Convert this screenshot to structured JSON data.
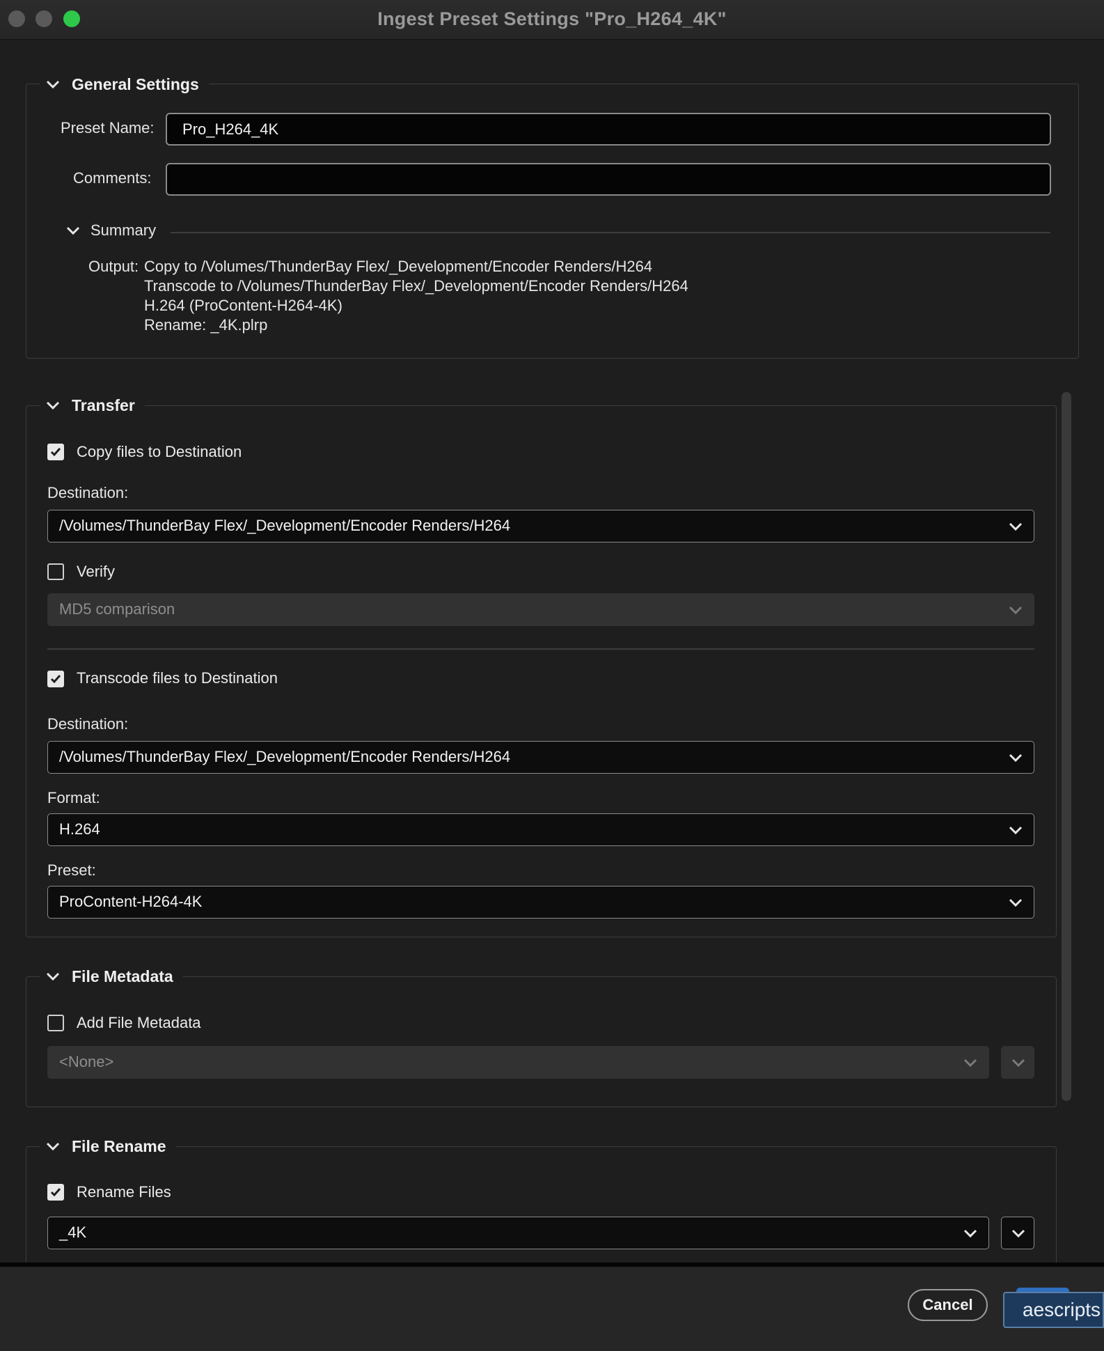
{
  "window": {
    "title": "Ingest Preset Settings \"Pro_H264_4K\""
  },
  "general": {
    "legend": "General Settings",
    "preset_name_label": "Preset Name:",
    "preset_name_value": "Pro_H264_4K",
    "comments_label": "Comments:",
    "comments_value": "",
    "summary_legend": "Summary",
    "output_label": "Output:",
    "summary_lines": [
      "Copy to /Volumes/ThunderBay Flex/_Development/Encoder Renders/H264",
      "Transcode to /Volumes/ThunderBay Flex/_Development/Encoder Renders/H264",
      "H.264 (ProContent-H264-4K)",
      "Rename: _4K.plrp"
    ]
  },
  "transfer": {
    "legend": "Transfer",
    "copy_label": "Copy files to Destination",
    "copy_checked": true,
    "copy_destination_label": "Destination:",
    "copy_destination_value": "/Volumes/ThunderBay Flex/_Development/Encoder Renders/H264",
    "verify_label": "Verify",
    "verify_checked": false,
    "verify_method": "MD5 comparison",
    "transcode_label": "Transcode files to Destination",
    "transcode_checked": true,
    "transcode_destination_label": "Destination:",
    "transcode_destination_value": "/Volumes/ThunderBay Flex/_Development/Encoder Renders/H264",
    "format_label": "Format:",
    "format_value": "H.264",
    "preset_label": "Preset:",
    "preset_value": "ProContent-H264-4K"
  },
  "metadata": {
    "legend": "File Metadata",
    "add_label": "Add File Metadata",
    "add_checked": false,
    "value": "<None>"
  },
  "rename": {
    "legend": "File Rename",
    "rename_label": "Rename Files",
    "rename_checked": true,
    "value": "_4K"
  },
  "footer": {
    "cancel_label": "Cancel",
    "ok_label": "aescripts"
  },
  "colors": {
    "background": "#1e1e1e",
    "close_light": "#5a5a5a",
    "zoom_light": "#2ec94a",
    "primary_button": "#1d3a5c"
  }
}
